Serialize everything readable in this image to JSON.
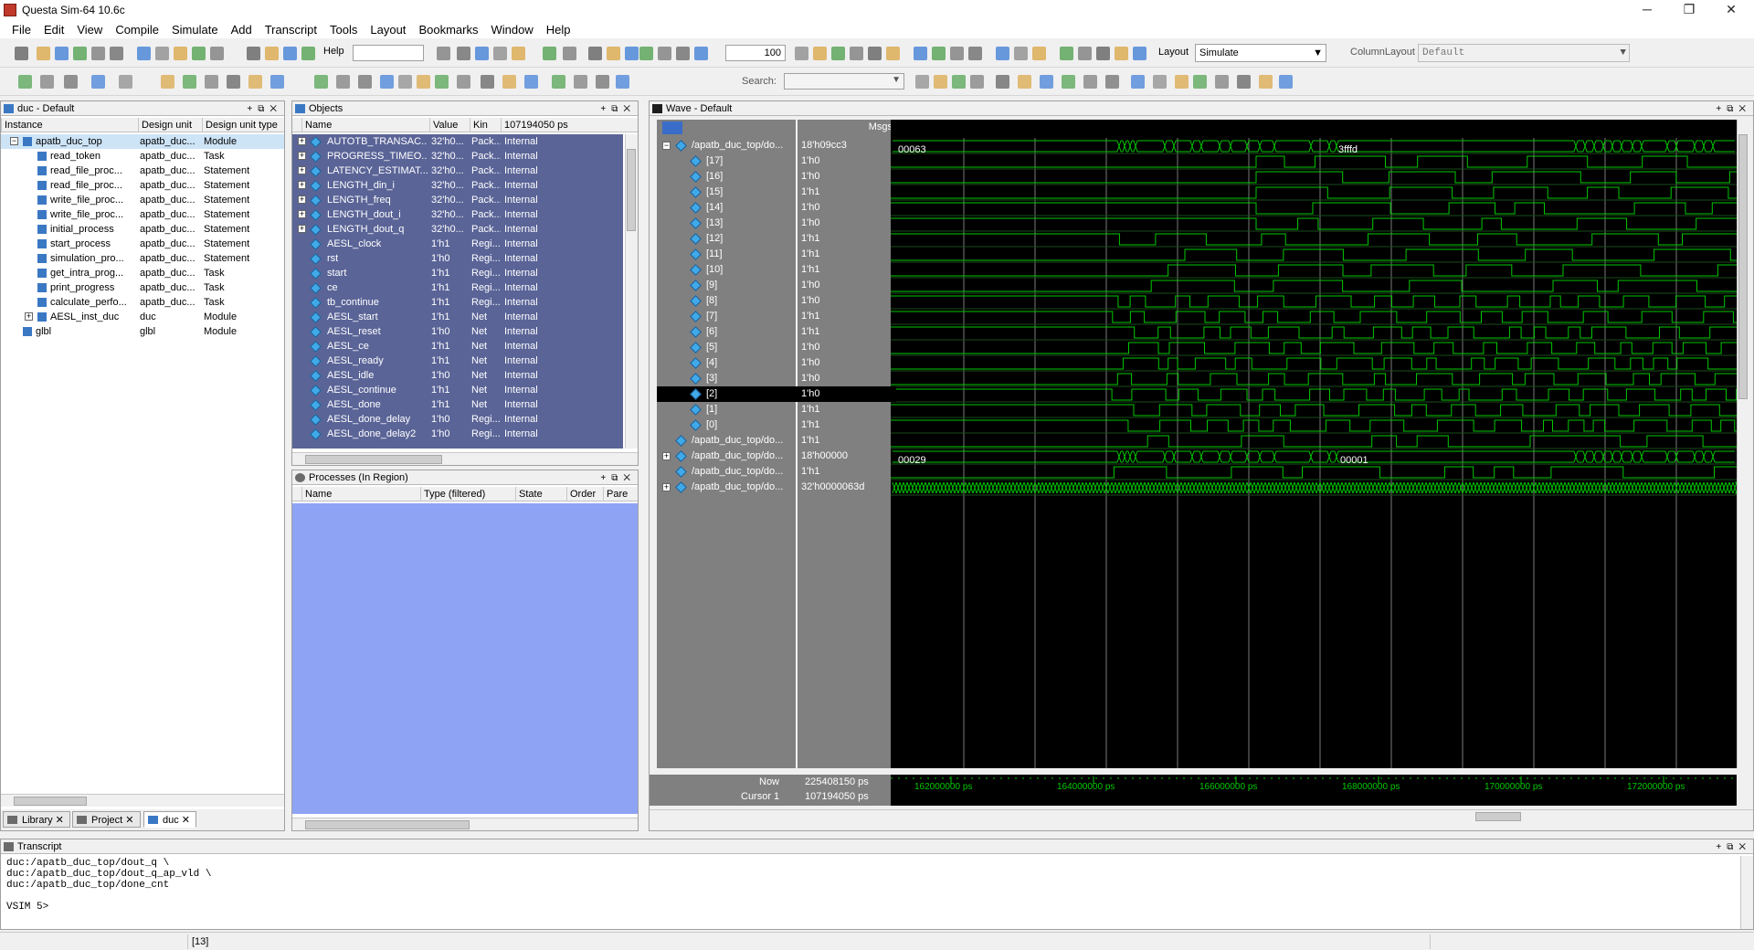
{
  "window": {
    "title": "Questa Sim-64 10.6c",
    "minimize": "─",
    "maximize": "❐",
    "close": "✕"
  },
  "menu": [
    "File",
    "Edit",
    "View",
    "Compile",
    "Simulate",
    "Add",
    "Transcript",
    "Tools",
    "Layout",
    "Bookmarks",
    "Window",
    "Help"
  ],
  "toolbar": {
    "help_label": "Help",
    "zoom_value": "100",
    "layout_label": "Layout",
    "layout_value": "Simulate",
    "column_layout_label": "ColumnLayout",
    "column_layout_value": "Default",
    "search_label": "Search:"
  },
  "instance_panel": {
    "title": "duc - Default",
    "columns": [
      "Instance",
      "Design unit",
      "Design unit type"
    ],
    "rows": [
      {
        "name": "apatb_duc_top",
        "unit": "apatb_duc...",
        "type": "Module",
        "level": 0,
        "expand": "−",
        "selected": true
      },
      {
        "name": "read_token",
        "unit": "apatb_duc...",
        "type": "Task",
        "level": 1,
        "expand": ""
      },
      {
        "name": "read_file_proc...",
        "unit": "apatb_duc...",
        "type": "Statement",
        "level": 1,
        "expand": ""
      },
      {
        "name": "read_file_proc...",
        "unit": "apatb_duc...",
        "type": "Statement",
        "level": 1,
        "expand": ""
      },
      {
        "name": "write_file_proc...",
        "unit": "apatb_duc...",
        "type": "Statement",
        "level": 1,
        "expand": ""
      },
      {
        "name": "write_file_proc...",
        "unit": "apatb_duc...",
        "type": "Statement",
        "level": 1,
        "expand": ""
      },
      {
        "name": "initial_process",
        "unit": "apatb_duc...",
        "type": "Statement",
        "level": 1,
        "expand": ""
      },
      {
        "name": "start_process",
        "unit": "apatb_duc...",
        "type": "Statement",
        "level": 1,
        "expand": ""
      },
      {
        "name": "simulation_pro...",
        "unit": "apatb_duc...",
        "type": "Statement",
        "level": 1,
        "expand": ""
      },
      {
        "name": "get_intra_prog...",
        "unit": "apatb_duc...",
        "type": "Task",
        "level": 1,
        "expand": ""
      },
      {
        "name": "print_progress",
        "unit": "apatb_duc...",
        "type": "Task",
        "level": 1,
        "expand": ""
      },
      {
        "name": "calculate_perfo...",
        "unit": "apatb_duc...",
        "type": "Task",
        "level": 1,
        "expand": ""
      },
      {
        "name": "AESL_inst_duc",
        "unit": "duc",
        "type": "Module",
        "level": 1,
        "expand": "+"
      },
      {
        "name": "glbl",
        "unit": "glbl",
        "type": "Module",
        "level": 0,
        "expand": ""
      }
    ],
    "tabs": [
      "Library",
      "Project",
      "duc"
    ]
  },
  "objects_panel": {
    "title": "Objects",
    "columns": [
      "Name",
      "Value",
      "Kin",
      "107194050 ps"
    ],
    "rows": [
      {
        "name": "AUTOTB_TRANSAC...",
        "value": "32'h0...",
        "kind": "Pack...",
        "mode": "Internal",
        "expand": "+"
      },
      {
        "name": "PROGRESS_TIMEO...",
        "value": "32'h0...",
        "kind": "Pack...",
        "mode": "Internal",
        "expand": "+"
      },
      {
        "name": "LATENCY_ESTIMAT...",
        "value": "32'h0...",
        "kind": "Pack...",
        "mode": "Internal",
        "expand": "+"
      },
      {
        "name": "LENGTH_din_i",
        "value": "32'h0...",
        "kind": "Pack...",
        "mode": "Internal",
        "expand": "+"
      },
      {
        "name": "LENGTH_freq",
        "value": "32'h0...",
        "kind": "Pack...",
        "mode": "Internal",
        "expand": "+"
      },
      {
        "name": "LENGTH_dout_i",
        "value": "32'h0...",
        "kind": "Pack...",
        "mode": "Internal",
        "expand": "+"
      },
      {
        "name": "LENGTH_dout_q",
        "value": "32'h0...",
        "kind": "Pack...",
        "mode": "Internal",
        "expand": "+"
      },
      {
        "name": "AESL_clock",
        "value": "1'h1",
        "kind": "Regi...",
        "mode": "Internal",
        "expand": ""
      },
      {
        "name": "rst",
        "value": "1'h0",
        "kind": "Regi...",
        "mode": "Internal",
        "expand": ""
      },
      {
        "name": "start",
        "value": "1'h1",
        "kind": "Regi...",
        "mode": "Internal",
        "expand": ""
      },
      {
        "name": "ce",
        "value": "1'h1",
        "kind": "Regi...",
        "mode": "Internal",
        "expand": ""
      },
      {
        "name": "tb_continue",
        "value": "1'h1",
        "kind": "Regi...",
        "mode": "Internal",
        "expand": ""
      },
      {
        "name": "AESL_start",
        "value": "1'h1",
        "kind": "Net",
        "mode": "Internal",
        "expand": ""
      },
      {
        "name": "AESL_reset",
        "value": "1'h0",
        "kind": "Net",
        "mode": "Internal",
        "expand": ""
      },
      {
        "name": "AESL_ce",
        "value": "1'h1",
        "kind": "Net",
        "mode": "Internal",
        "expand": ""
      },
      {
        "name": "AESL_ready",
        "value": "1'h1",
        "kind": "Net",
        "mode": "Internal",
        "expand": ""
      },
      {
        "name": "AESL_idle",
        "value": "1'h0",
        "kind": "Net",
        "mode": "Internal",
        "expand": ""
      },
      {
        "name": "AESL_continue",
        "value": "1'h1",
        "kind": "Net",
        "mode": "Internal",
        "expand": ""
      },
      {
        "name": "AESL_done",
        "value": "1'h1",
        "kind": "Net",
        "mode": "Internal",
        "expand": ""
      },
      {
        "name": "AESL_done_delay",
        "value": "1'h0",
        "kind": "Regi...",
        "mode": "Internal",
        "expand": ""
      },
      {
        "name": "AESL_done_delay2",
        "value": "1'h0",
        "kind": "Regi...",
        "mode": "Internal",
        "expand": ""
      }
    ]
  },
  "processes_panel": {
    "title": "Processes (In Region)",
    "columns": [
      "Name",
      "Type (filtered)",
      "State",
      "Order",
      "Pare"
    ]
  },
  "wave_panel": {
    "title": "Wave - Default",
    "msgs_label": "Msgs",
    "signals": [
      {
        "name": "/apatb_duc_top/do...",
        "value": "18'h09cc3",
        "expand": "−",
        "indent": 0,
        "bus": true
      },
      {
        "name": "[17]",
        "value": "1'h0",
        "expand": "",
        "indent": 1
      },
      {
        "name": "[16]",
        "value": "1'h0",
        "expand": "",
        "indent": 1
      },
      {
        "name": "[15]",
        "value": "1'h1",
        "expand": "",
        "indent": 1
      },
      {
        "name": "[14]",
        "value": "1'h0",
        "expand": "",
        "indent": 1
      },
      {
        "name": "[13]",
        "value": "1'h0",
        "expand": "",
        "indent": 1
      },
      {
        "name": "[12]",
        "value": "1'h1",
        "expand": "",
        "indent": 1
      },
      {
        "name": "[11]",
        "value": "1'h1",
        "expand": "",
        "indent": 1
      },
      {
        "name": "[10]",
        "value": "1'h1",
        "expand": "",
        "indent": 1
      },
      {
        "name": "[9]",
        "value": "1'h0",
        "expand": "",
        "indent": 1
      },
      {
        "name": "[8]",
        "value": "1'h0",
        "expand": "",
        "indent": 1
      },
      {
        "name": "[7]",
        "value": "1'h1",
        "expand": "",
        "indent": 1
      },
      {
        "name": "[6]",
        "value": "1'h1",
        "expand": "",
        "indent": 1
      },
      {
        "name": "[5]",
        "value": "1'h0",
        "expand": "",
        "indent": 1
      },
      {
        "name": "[4]",
        "value": "1'h0",
        "expand": "",
        "indent": 1
      },
      {
        "name": "[3]",
        "value": "1'h0",
        "expand": "",
        "indent": 1
      },
      {
        "name": "[2]",
        "value": "1'h0",
        "expand": "",
        "indent": 1,
        "selected": true
      },
      {
        "name": "[1]",
        "value": "1'h1",
        "expand": "",
        "indent": 1
      },
      {
        "name": "[0]",
        "value": "1'h1",
        "expand": "",
        "indent": 1
      },
      {
        "name": "/apatb_duc_top/do...",
        "value": "1'h1",
        "expand": "",
        "indent": 0
      },
      {
        "name": "/apatb_duc_top/do...",
        "value": "18'h00000",
        "expand": "+",
        "indent": 0,
        "bus": true
      },
      {
        "name": "/apatb_duc_top/do...",
        "value": "1'h1",
        "expand": "",
        "indent": 0
      },
      {
        "name": "/apatb_duc_top/do...",
        "value": "32'h0000063d",
        "expand": "+",
        "indent": 0,
        "bus": true
      }
    ],
    "bus_labels": {
      "row0_left": "00063",
      "row0_right": "3fffd",
      "row20_left": "00029",
      "row20_right": "00001"
    },
    "now_label": "Now",
    "now_value": "225408150 ps",
    "cursor_label": "Cursor 1",
    "cursor_value": "107194050 ps",
    "timeline": [
      "162000000 ps",
      "164000000 ps",
      "166000000 ps",
      "168000000 ps",
      "170000000 ps",
      "172000000 ps"
    ],
    "colors": {
      "wave": "#00c800",
      "bg": "#000000",
      "grid": "#808080",
      "name_bg": "#808080"
    }
  },
  "transcript": {
    "title": "Transcript",
    "lines": [
      "duc:/apatb_duc_top/dout_q \\",
      "duc:/apatb_duc_top/dout_q_ap_vld \\",
      "duc:/apatb_duc_top/done_cnt"
    ],
    "prompt": "VSIM 5>"
  },
  "status": {
    "field": "[13]"
  }
}
